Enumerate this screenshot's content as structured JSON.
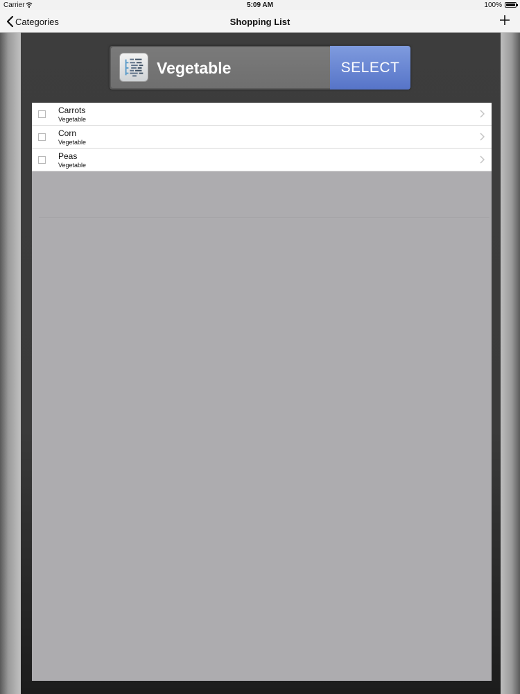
{
  "status_bar": {
    "carrier": "Carrier",
    "time": "5:09 AM",
    "battery": "100%"
  },
  "nav": {
    "back_label": "Categories",
    "title": "Shopping List",
    "add_icon": "plus-icon"
  },
  "picker": {
    "category": "Vegetable",
    "select_label": "SELECT",
    "icon": "category-list-icon"
  },
  "items": [
    {
      "title": "Carrots",
      "subtitle": "Vegetable"
    },
    {
      "title": "Corn",
      "subtitle": "Vegetable"
    },
    {
      "title": "Peas",
      "subtitle": "Vegetable"
    }
  ],
  "colors": {
    "select_button": "#6a86d4",
    "panel": "#3a3a3a",
    "list_background": "#adacaf"
  }
}
